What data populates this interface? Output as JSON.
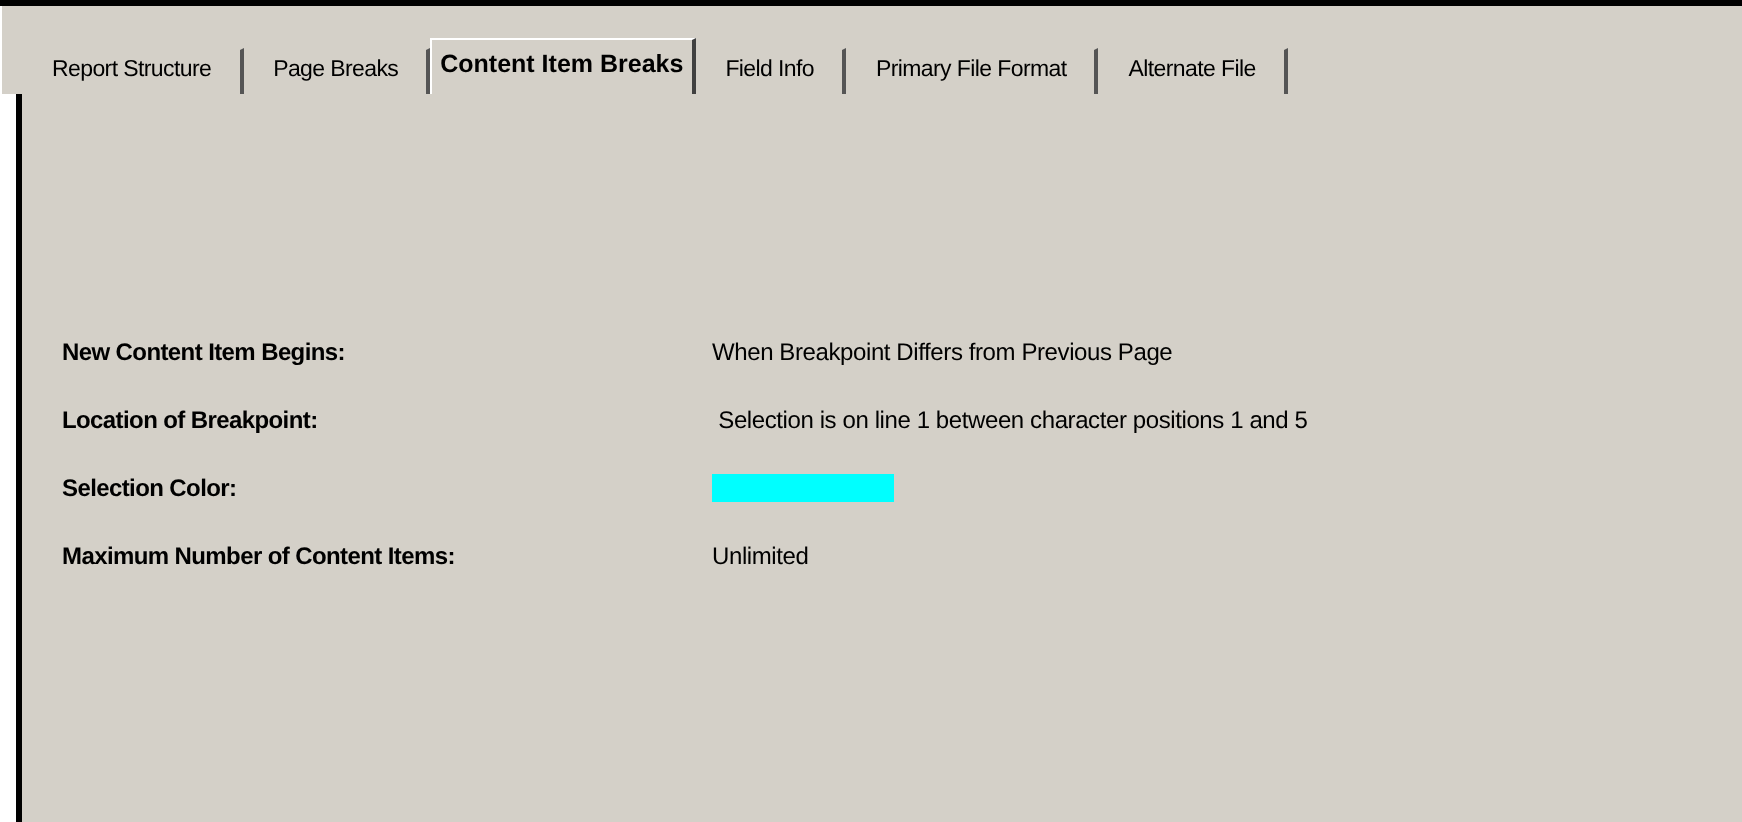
{
  "tabs": [
    {
      "label": "Report Structure",
      "selected": false
    },
    {
      "label": "Page Breaks",
      "selected": false
    },
    {
      "label": "Content Item Breaks",
      "selected": true
    },
    {
      "label": "Field Info",
      "selected": false
    },
    {
      "label": "Primary File Format",
      "selected": false
    },
    {
      "label": "Alternate File",
      "selected": false
    }
  ],
  "fields": [
    {
      "kind": "text",
      "label": "New Content Item Begins:",
      "value": "When Breakpoint Differs from Previous Page"
    },
    {
      "kind": "text",
      "label": "Location of Breakpoint:",
      "value": " Selection is on line 1 between character positions 1 and 5"
    },
    {
      "kind": "color",
      "label": "Selection Color:",
      "color": "#00ffff"
    },
    {
      "kind": "text",
      "label": "Maximum Number of Content Items:",
      "value": "Unlimited"
    }
  ]
}
